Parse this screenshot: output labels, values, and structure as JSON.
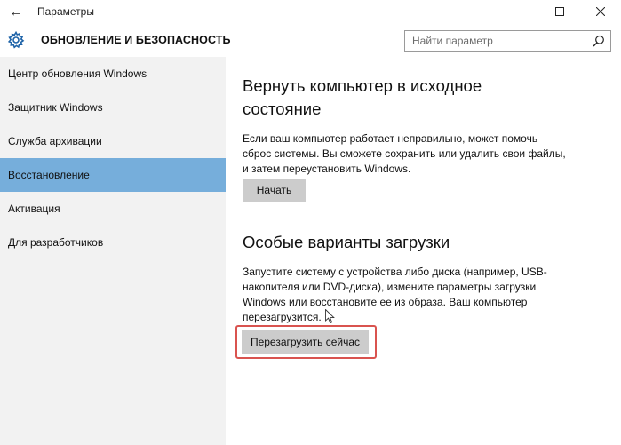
{
  "window": {
    "title": "Параметры",
    "back_icon": "back-arrow-icon",
    "controls": [
      "minimize-icon",
      "maximize-icon",
      "close-icon"
    ]
  },
  "header": {
    "section_title": "ОБНОВЛЕНИЕ И БЕЗОПАСНОСТЬ",
    "icon": "gear-icon",
    "search_placeholder": "Найти параметр"
  },
  "sidebar": {
    "items": [
      {
        "label": "Центр обновления Windows"
      },
      {
        "label": "Защитник Windows"
      },
      {
        "label": "Служба архивации"
      },
      {
        "label": "Восстановление",
        "active": true
      },
      {
        "label": "Активация"
      },
      {
        "label": "Для разработчиков"
      }
    ],
    "accent_color": "#76aedb"
  },
  "main": {
    "reset": {
      "title_line1": "Вернуть компьютер в исходное",
      "title_line2": "состояние",
      "desc_line1": "Если ваш компьютер работает неправильно, может помочь",
      "desc_line2": "сброс системы. Вы сможете сохранить или удалить свои файлы,",
      "desc_line3": "и затем переустановить Windows.",
      "button": "Начать"
    },
    "advanced": {
      "title": "Особые варианты загрузки",
      "desc_line1": "Запустите систему с устройства либо диска (например, USB-",
      "desc_line2": "накопителя или DVD-диска), измените параметры загрузки",
      "desc_line3": "Windows или восстановите ее из образа. Ваш компьютер",
      "desc_line4": "перезагрузится.",
      "button": "Перезагрузить сейчас",
      "highlight_color": "#d9534f"
    }
  }
}
